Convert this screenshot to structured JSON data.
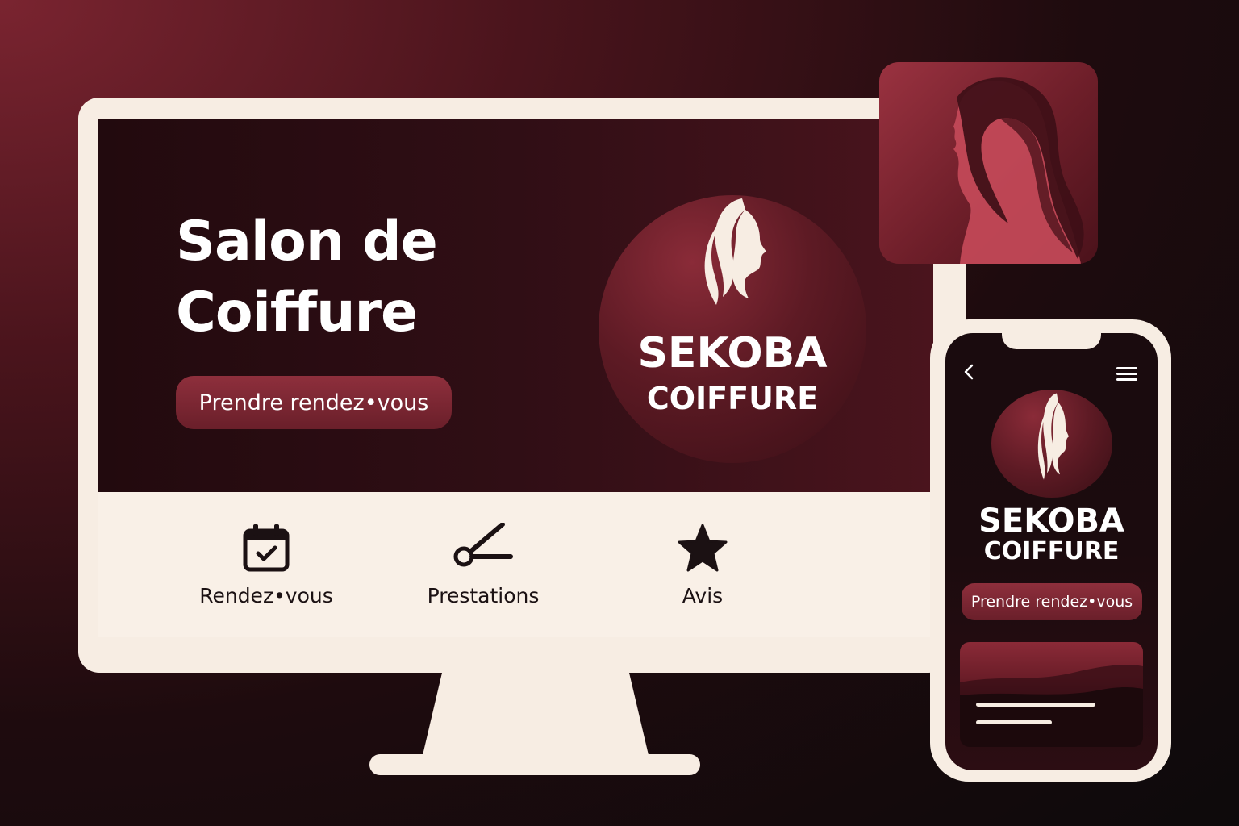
{
  "desktop": {
    "hero_title_line1": "Salon de",
    "hero_title_line2": "Coiffure",
    "cta_label": "Prendre rendez•vous",
    "logo": {
      "name": "SEKOBA",
      "subtitle": "COIFFURE"
    },
    "features": [
      {
        "label": "Rendez•vous",
        "icon": "calendar-check-icon"
      },
      {
        "label": "Prestations",
        "icon": "scissors-icon"
      },
      {
        "label": "Avis",
        "icon": "star-icon"
      }
    ]
  },
  "app_icon": {
    "icon": "woman-profile-icon"
  },
  "mobile": {
    "logo": {
      "name": "SEKOBA",
      "subtitle": "COIFFURE"
    },
    "cta_label": "Prendre rendez•vous",
    "back_icon": "chevron-left-icon",
    "menu_icon": "hamburger-menu-icon"
  },
  "colors": {
    "brand_burgundy": "#6a1f2a",
    "brand_dark": "#1e0b0e",
    "cream": "#f7ede3",
    "white": "#ffffff"
  }
}
